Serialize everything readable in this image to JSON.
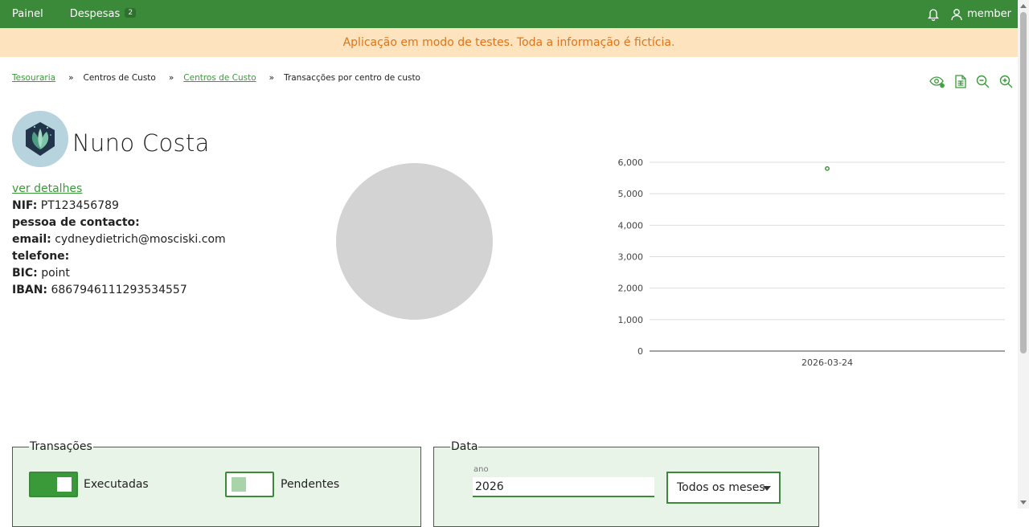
{
  "nav": {
    "painel": "Painel",
    "despesas": "Despesas",
    "despesas_badge": "2",
    "user": "member"
  },
  "banner": "Aplicação em modo de testes. Toda a informação é fictícia.",
  "breadcrumb": {
    "items": [
      "Tesouraria",
      "Centros de Custo",
      "Centros de Custo",
      "Transacções por centro de custo"
    ],
    "separator": "»"
  },
  "toolbar": {
    "icons": [
      "eye-settings-icon",
      "spreadsheet-icon",
      "zoom-out-icon",
      "zoom-in-icon"
    ]
  },
  "profile": {
    "name": "Nuno Costa",
    "details_link": "ver detalhes",
    "fields": [
      {
        "label": "NIF:",
        "value": "PT123456789"
      },
      {
        "label": "pessoa de contacto:",
        "value": ""
      },
      {
        "label": "email:",
        "value": "cydneydietrich@mosciski.com"
      },
      {
        "label": "telefone:",
        "value": ""
      },
      {
        "label": "BIC:",
        "value": "point"
      },
      {
        "label": "IBAN:",
        "value": "6867946111293534557"
      }
    ]
  },
  "chart_data": {
    "type": "scatter",
    "categories": [
      "2026-03-24"
    ],
    "values": [
      5800
    ],
    "ylim": [
      0,
      6000
    ],
    "yticks": [
      0,
      1000,
      2000,
      3000,
      4000,
      5000,
      6000
    ],
    "ytick_labels": [
      "0",
      "1,000",
      "2,000",
      "3,000",
      "4,000",
      "5,000",
      "6,000"
    ],
    "grid": true,
    "color": "#3a9a3a"
  },
  "filters": {
    "transactions": {
      "legend": "Transações",
      "executed_label": "Executadas",
      "executed_on": true,
      "pending_label": "Pendentes",
      "pending_on": false
    },
    "date": {
      "legend": "Data",
      "year_label": "ano",
      "year_value": "2026",
      "month_value": "Todos os meses"
    }
  },
  "colors": {
    "primary": "#3a8a3a",
    "banner_bg": "#fde3be",
    "banner_text": "#e0741a",
    "fieldset_bg": "#e8f4e8",
    "pie": "#d3d3d3"
  }
}
